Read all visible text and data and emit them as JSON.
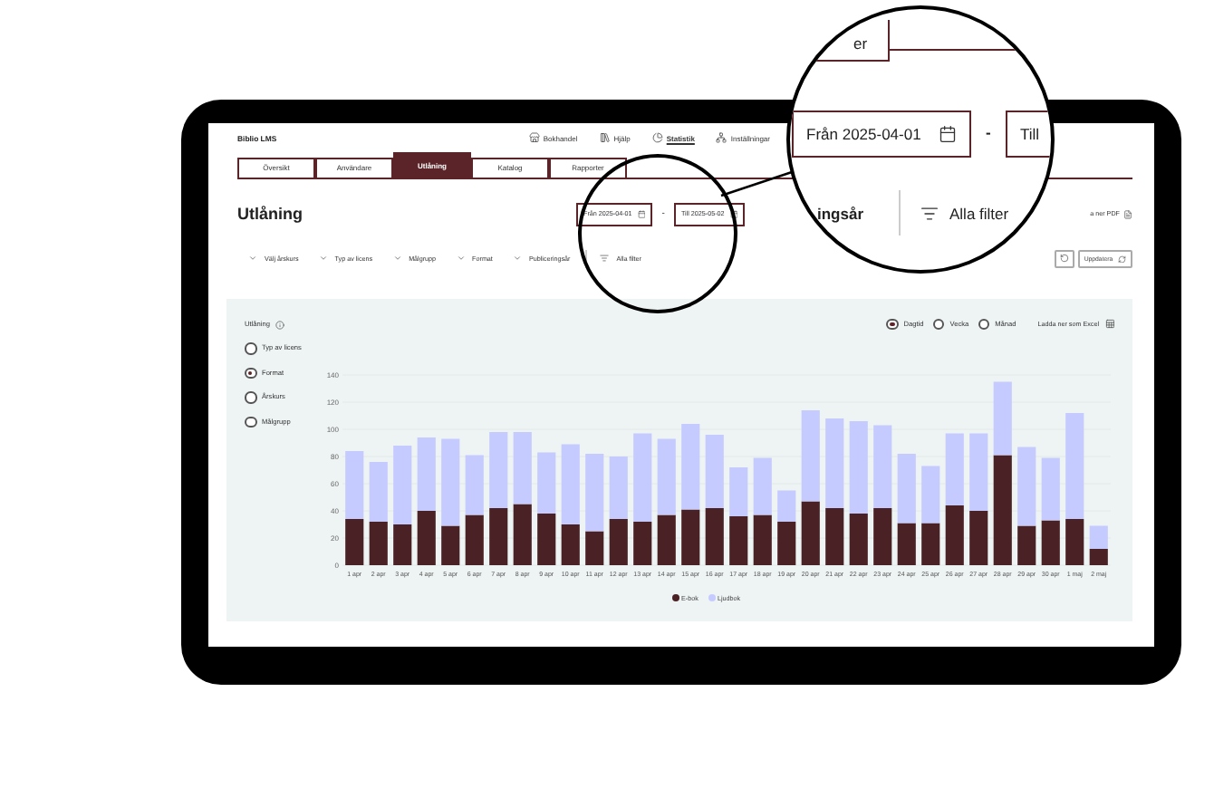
{
  "app": {
    "name": "Biblio LMS"
  },
  "nav": [
    {
      "label": "Bokhandel",
      "selected": false
    },
    {
      "label": "Hjälp",
      "selected": false
    },
    {
      "label": "Statistik",
      "selected": true
    },
    {
      "label": "Inställningar",
      "selected": false
    }
  ],
  "tabs": [
    {
      "label": "Översikt",
      "selected": false
    },
    {
      "label": "Användare",
      "selected": false
    },
    {
      "label": "Utlåning",
      "selected": true
    },
    {
      "label": "Katalog",
      "selected": false
    },
    {
      "label": "Rapporter",
      "selected": false
    }
  ],
  "page": {
    "title": "Utlåning",
    "from_date": "Från 2025-04-01",
    "separator": "-",
    "to_date": "Till 2025-05-02",
    "pdf_button": "a ner PDF"
  },
  "filters": [
    "Välj årskurs",
    "Typ av licens",
    "Målgrupp",
    "Format",
    "Publiceringsår"
  ],
  "all_filters": "Alla filter",
  "update_button": "Uppdatera",
  "panel": {
    "title": "Utlåning",
    "periods": [
      {
        "label": "Dagtid",
        "selected": true
      },
      {
        "label": "Vecka",
        "selected": false
      },
      {
        "label": "Månad",
        "selected": false
      }
    ],
    "excel_button": "Ladda ner som Excel",
    "groupings": [
      {
        "label": "Typ av licens",
        "selected": false
      },
      {
        "label": "Format",
        "selected": true
      },
      {
        "label": "Årskurs",
        "selected": false
      },
      {
        "label": "Målgrupp",
        "selected": false
      }
    ],
    "chart_data": {
      "type": "bar",
      "stacked": true,
      "grid": true,
      "legend": true,
      "ylim": [
        0,
        140
      ],
      "yticks": [
        0,
        20,
        40,
        60,
        80,
        100,
        120,
        140
      ],
      "categories": [
        "1 apr",
        "2 apr",
        "3 apr",
        "4 apr",
        "5 apr",
        "6 apr",
        "7 apr",
        "8 apr",
        "9 apr",
        "10 apr",
        "11 apr",
        "12 apr",
        "13 apr",
        "14 apr",
        "15 apr",
        "16 apr",
        "17 apr",
        "18 apr",
        "19 apr",
        "20 apr",
        "21 apr",
        "22 apr",
        "23 apr",
        "24 apr",
        "25 apr",
        "26 apr",
        "27 apr",
        "28 apr",
        "29 apr",
        "30 apr",
        "1 maj",
        "2 maj"
      ],
      "series": [
        {
          "name": "E-bok",
          "color": "#4a2124",
          "values": [
            34,
            32,
            30,
            40,
            29,
            37,
            42,
            45,
            38,
            30,
            25,
            34,
            32,
            37,
            41,
            42,
            36,
            37,
            32,
            47,
            42,
            38,
            42,
            31,
            31,
            44,
            40,
            81,
            29,
            33,
            34,
            12
          ]
        },
        {
          "name": "Ljudbok",
          "color": "#c6cbff",
          "values": [
            50,
            44,
            58,
            54,
            64,
            44,
            56,
            53,
            45,
            59,
            57,
            46,
            65,
            56,
            63,
            54,
            36,
            42,
            23,
            67,
            66,
            68,
            61,
            51,
            42,
            53,
            57,
            54,
            58,
            46,
            78,
            17
          ]
        }
      ]
    }
  },
  "magnifier": {
    "tab_fragment": "er",
    "from_date": "Från 2025-04-01",
    "separator": "-",
    "to_fragment": "Till",
    "filter_fragment": "ingsår",
    "all_filters": "Alla filter"
  }
}
